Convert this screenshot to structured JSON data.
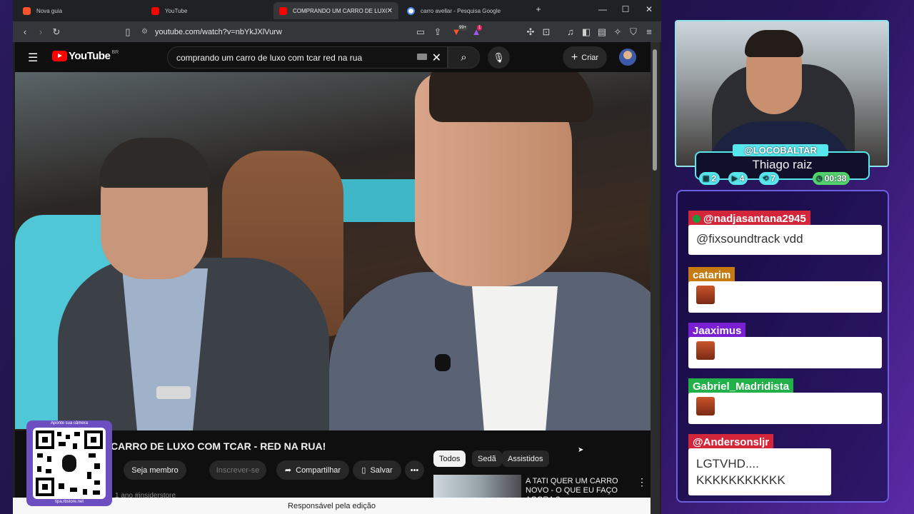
{
  "browser": {
    "tabs": [
      {
        "label": "Nova guia"
      },
      {
        "label": "YouTube"
      },
      {
        "label": "COMPRANDO UM CARRO DE LUXO CO"
      },
      {
        "label": "carro avellar - Pesquisa Google"
      }
    ],
    "url": "youtube.com/watch?v=nbYkJXlVurw",
    "badges": {
      "brave": "99+",
      "alerts": "1"
    }
  },
  "youtube": {
    "logo": "YouTube",
    "region": "BR",
    "search_value": "comprando um carro de luxo com tcar red na rua",
    "create_label": "Criar",
    "video_title": "CARRO DE LUXO COM TCAR - RED NA RUA!",
    "join_label": "Seja membro",
    "subscribe_label": "Inscrever-se",
    "share_label": "Compartilhar",
    "save_label": "Salvar",
    "meta": "1 ano  #insiderstore",
    "chips": [
      "Todos",
      "Sedã",
      "Assistidos"
    ],
    "rec_title": "A TATI QUER UM CARRO NOVO - O QUE EU FAÇO AGORA ?"
  },
  "status_bar": "Responsável pela edição",
  "qr": {
    "top": "Aponte sua câmera",
    "bottom": "tipa.rbstore.net"
  },
  "stream": {
    "handle": "@LOCOBALTAR",
    "name": "Thiago raiz",
    "stats": [
      "2",
      "4",
      "7"
    ],
    "timer": "00:38"
  },
  "chat": [
    {
      "user": "@nadjasantana2945",
      "text": "@fixsoundtrack vdd",
      "color": "#d3263a"
    },
    {
      "user": "catarim",
      "text": "",
      "color": "#c77a10"
    },
    {
      "user": "Jaaximus",
      "text": "",
      "color": "#7a1fd1"
    },
    {
      "user": "Gabriel_Madridista",
      "text": "",
      "color": "#22b04a"
    },
    {
      "user": "@Andersonsljr",
      "text": "LGTVHD.... KKKKKKKKKKK",
      "color": "#d3263a"
    }
  ]
}
